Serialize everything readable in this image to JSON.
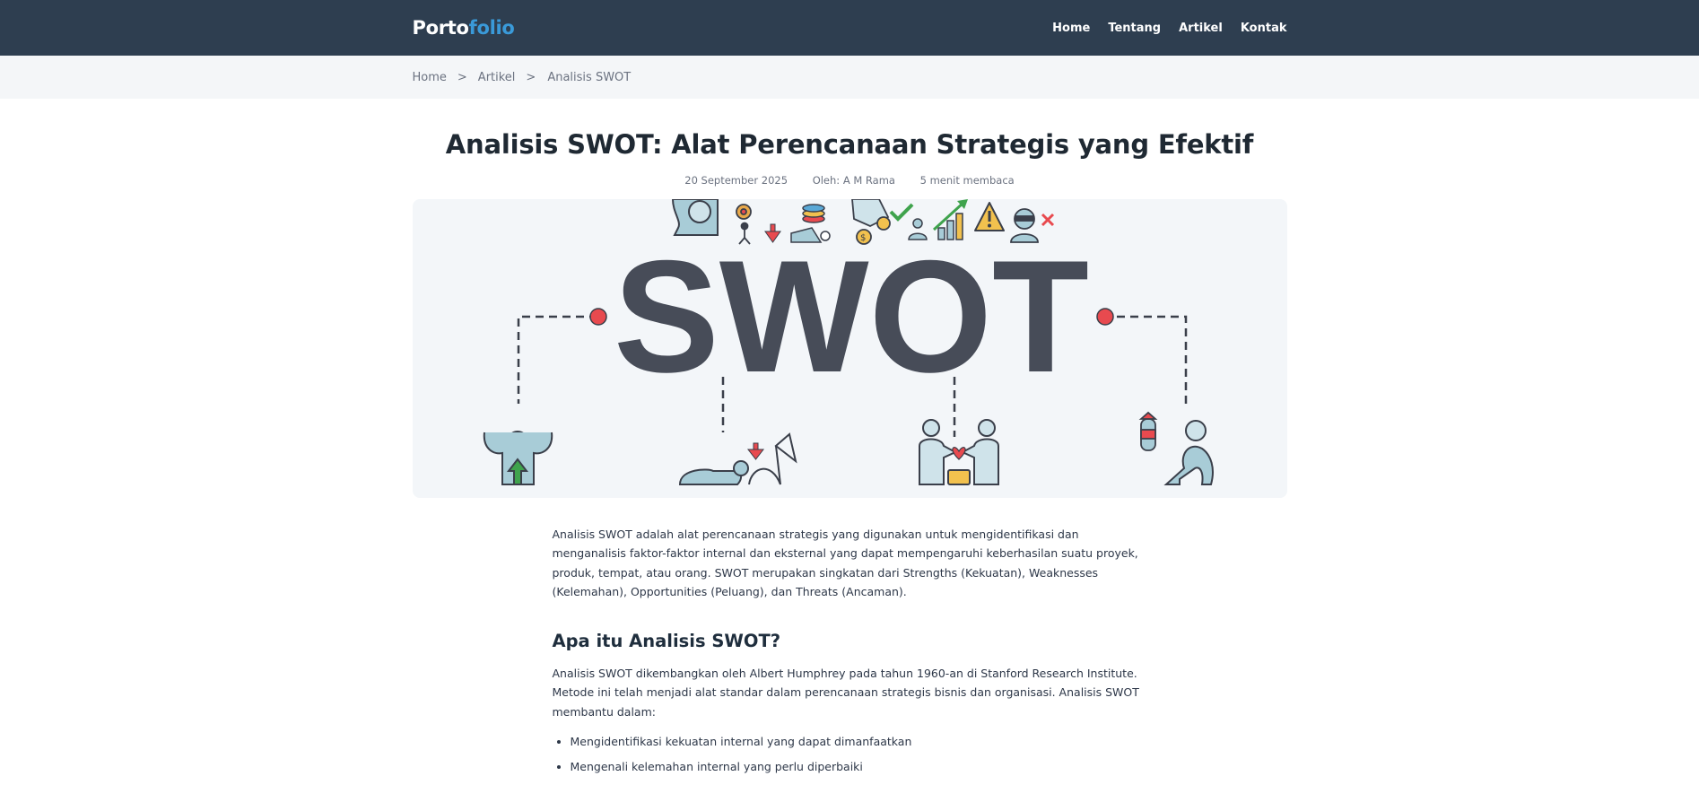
{
  "header": {
    "logo_part1": "Porto",
    "logo_part2": "folio",
    "nav": [
      "Home",
      "Tentang",
      "Artikel",
      "Kontak"
    ]
  },
  "breadcrumb": {
    "home": "Home",
    "sep": ">",
    "section": "Artikel",
    "current": "Analisis SWOT"
  },
  "article": {
    "title": "Analisis SWOT: Alat Perencanaan Strategis yang Efektif",
    "date": "20 September 2025",
    "author": "Oleh: A M Rama",
    "read_time": "5 menit membaca",
    "hero_text": "SWOT",
    "intro": "Analisis SWOT adalah alat perencanaan strategis yang digunakan untuk mengidentifikasi dan menganalisis faktor-faktor internal dan eksternal yang dapat mempengaruhi keberhasilan suatu proyek, produk, tempat, atau orang. SWOT merupakan singkatan dari Strengths (Kekuatan), Weaknesses (Kelemahan), Opportunities (Peluang), dan Threats (Ancaman).",
    "section1_heading": "Apa itu Analisis SWOT?",
    "section1_body": "Analisis SWOT dikembangkan oleh Albert Humphrey pada tahun 1960-an di Stanford Research Institute. Metode ini telah menjadi alat standar dalam perencanaan strategis bisnis dan organisasi. Analisis SWOT membantu dalam:",
    "bullets": [
      "Mengidentifikasi kekuatan internal yang dapat dimanfaatkan",
      "Mengenali kelemahan internal yang perlu diperbaiki"
    ]
  },
  "colors": {
    "header_bg": "#2e3e50",
    "logo_accent": "#3a9ad9",
    "hero_bg": "#f3f6f9",
    "swot_text": "#474c58",
    "dot_red": "#e84a4f"
  },
  "icons": [
    "brain-icon",
    "gear-person-icon",
    "arrow-down-icon",
    "coins-stack-icon",
    "handshake-icon",
    "check-icon",
    "growth-chart-icon",
    "warning-icon",
    "person-x-icon",
    "strong-person-icon",
    "kneeling-person-icon",
    "partnership-icon",
    "bomb-icon",
    "crouching-person-icon"
  ]
}
